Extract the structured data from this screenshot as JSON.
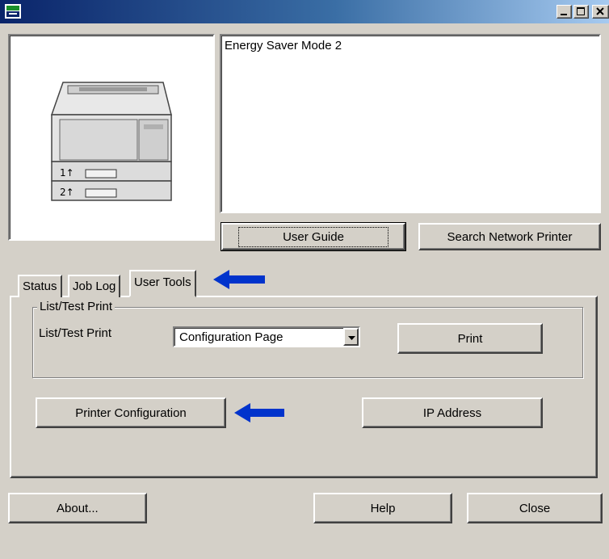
{
  "window": {
    "title": "",
    "controls": [
      "minimize",
      "maximize",
      "close"
    ],
    "colors": {
      "face": "#d4d0c8",
      "titlebar": "#0a246a",
      "arrow": "#0033cc"
    }
  },
  "status_monitor": {
    "message": "Energy Saver Mode 2"
  },
  "printer_image": {
    "tray_labels": [
      "1",
      "2"
    ]
  },
  "top_buttons": {
    "user_guide": "User Guide",
    "search_network_printer": "Search Network Printer"
  },
  "tabs": [
    {
      "label": "Status",
      "active": false
    },
    {
      "label": "Job Log",
      "active": false
    },
    {
      "label": "User Tools",
      "active": true
    }
  ],
  "user_tools": {
    "group_title": "List/Test Print",
    "list_label": "List/Test Print",
    "list_select_value": "Configuration Page",
    "print_button": "Print",
    "printer_configuration_button": "Printer Configuration",
    "ip_address_button": "IP Address"
  },
  "bottom_buttons": {
    "about": "About...",
    "help": "Help",
    "close": "Close"
  }
}
